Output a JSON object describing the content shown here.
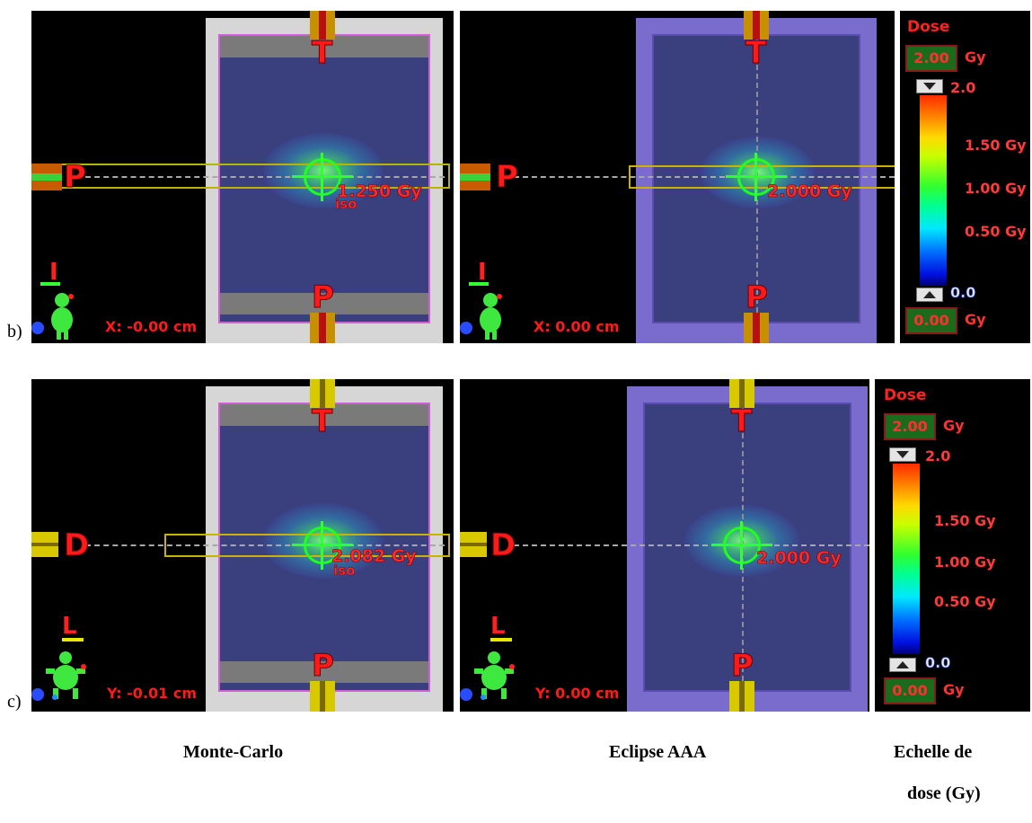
{
  "rows": [
    {
      "label": "b)",
      "orientation": "I",
      "panels": [
        {
          "name": "monte-carlo",
          "top_label": "T",
          "bottom_label": "P",
          "side_label": "P",
          "dose_value": "1.250 Gy",
          "iso_label": "iso",
          "coord": "X: -0.00 cm"
        },
        {
          "name": "eclipse",
          "top_label": "T",
          "bottom_label": "P",
          "side_label": "P",
          "dose_value": "2.000 Gy",
          "coord": "X: 0.00 cm"
        }
      ],
      "scale": {
        "title": "Dose",
        "max_box": "2.00",
        "min_box": "0.00",
        "unit": "Gy",
        "top_value": "2.0",
        "bottom_value": "0.0",
        "ticks": [
          "1.50 Gy",
          "1.00 Gy",
          "0.50 Gy"
        ]
      }
    },
    {
      "label": "c)",
      "orientation": "L",
      "panels": [
        {
          "name": "monte-carlo",
          "top_label": "T",
          "bottom_label": "P",
          "side_label": "D",
          "dose_value": "2.082 Gy",
          "iso_label": "iso",
          "coord": "Y: -0.01 cm"
        },
        {
          "name": "eclipse",
          "top_label": "T",
          "bottom_label": "P",
          "side_label": "D",
          "dose_value": "2.000 Gy",
          "coord": "Y: 0.00 cm"
        }
      ],
      "scale": {
        "title": "Dose",
        "max_box": "2.00",
        "min_box": "0.00",
        "unit": "Gy",
        "top_value": "2.0",
        "bottom_value": "0.0",
        "ticks": [
          "1.50 Gy",
          "1.00 Gy",
          "0.50 Gy"
        ]
      }
    }
  ],
  "captions": {
    "monte_carlo": "Monte-Carlo",
    "eclipse": "Eclipse AAA",
    "scale_line1": "Echelle de",
    "scale_line2": "dose (Gy)"
  },
  "colors": {
    "panel_bg": "#000000",
    "phantom_fill": "#3a3f7e",
    "frame_light": "#d6d6d6",
    "frame_purple": "#7a6ccc",
    "label_red": "#ff1a1a",
    "cross_green": "#30ff30",
    "beam_yellow": "#c8b400"
  }
}
